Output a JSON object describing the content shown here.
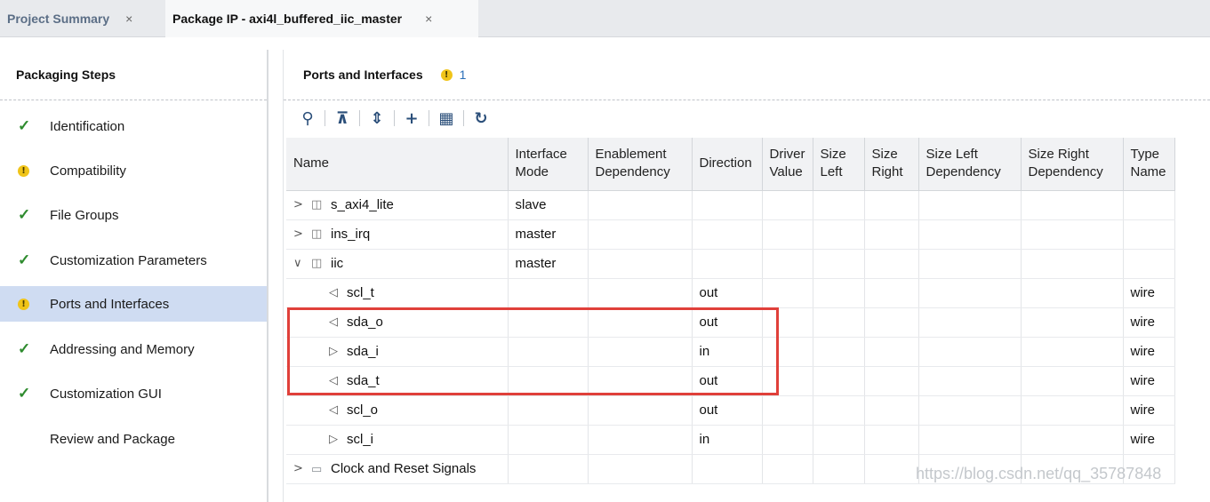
{
  "tabs": [
    {
      "label": "Project Summary",
      "close": "×"
    },
    {
      "label": "Package IP - axi4l_buffered_iic_master",
      "close": "×"
    }
  ],
  "left_panel": {
    "title": "Packaging Steps",
    "steps": [
      {
        "label": "Identification",
        "status": "check"
      },
      {
        "label": "Compatibility",
        "status": "warning"
      },
      {
        "label": "File Groups",
        "status": "check"
      },
      {
        "label": "Customization Parameters",
        "status": "check"
      },
      {
        "label": "Ports and Interfaces",
        "status": "warning",
        "selected": true
      },
      {
        "label": "Addressing and Memory",
        "status": "check"
      },
      {
        "label": "Customization GUI",
        "status": "check"
      },
      {
        "label": "Review and Package",
        "status": "none"
      }
    ]
  },
  "right_panel": {
    "title": "Ports and Interfaces",
    "warning_count": "1",
    "toolbar": [
      "search-icon",
      "collapse-all-icon",
      "expand-all-icon",
      "add-icon",
      "bus-interface-icon",
      "refresh-icon"
    ]
  },
  "table": {
    "headers": [
      "Name",
      "Interface Mode",
      "Enablement Dependency",
      "Direction",
      "Driver Value",
      "Size Left",
      "Size Right",
      "Size Left Dependency",
      "Size Right Dependency",
      "Type Name"
    ],
    "rows": [
      {
        "name": "s_axi4_lite",
        "kind": "bus",
        "expander": "collapsed",
        "mode": "slave",
        "direction": "",
        "type": ""
      },
      {
        "name": "ins_irq",
        "kind": "bus",
        "expander": "collapsed",
        "mode": "master",
        "direction": "",
        "type": ""
      },
      {
        "name": "iic",
        "kind": "bus",
        "expander": "expanded",
        "mode": "master",
        "direction": "",
        "type": ""
      },
      {
        "name": "scl_t",
        "kind": "port-out",
        "mode": "",
        "direction": "out",
        "type": "wire"
      },
      {
        "name": "sda_o",
        "kind": "port-out",
        "mode": "",
        "direction": "out",
        "type": "wire"
      },
      {
        "name": "sda_i",
        "kind": "port-in",
        "mode": "",
        "direction": "in",
        "type": "wire"
      },
      {
        "name": "sda_t",
        "kind": "port-out",
        "mode": "",
        "direction": "out",
        "type": "wire"
      },
      {
        "name": "scl_o",
        "kind": "port-out",
        "mode": "",
        "direction": "out",
        "type": "wire"
      },
      {
        "name": "scl_i",
        "kind": "port-in",
        "mode": "",
        "direction": "in",
        "type": "wire"
      },
      {
        "name": "Clock and Reset Signals",
        "kind": "folder",
        "expander": "collapsed",
        "mode": "",
        "direction": "",
        "type": ""
      }
    ]
  },
  "watermark": "https://blog.csdn.net/qq_35787848",
  "colors": {
    "accent": "#2a6fb8",
    "selection": "#cfdcf2",
    "highlight_box": "#e0403a",
    "check": "#2e8b2e",
    "warning": "#f0c419"
  }
}
